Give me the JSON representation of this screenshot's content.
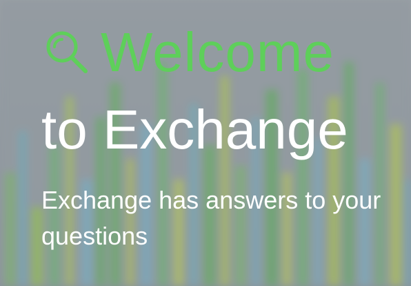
{
  "hero": {
    "welcome": "Welcome",
    "title_line2": "to Exchange",
    "subtitle": "Exchange has answers to your questions"
  },
  "colors": {
    "accent": "#5ecf5a",
    "text": "#ffffff"
  },
  "icons": {
    "search": "search-icon"
  }
}
